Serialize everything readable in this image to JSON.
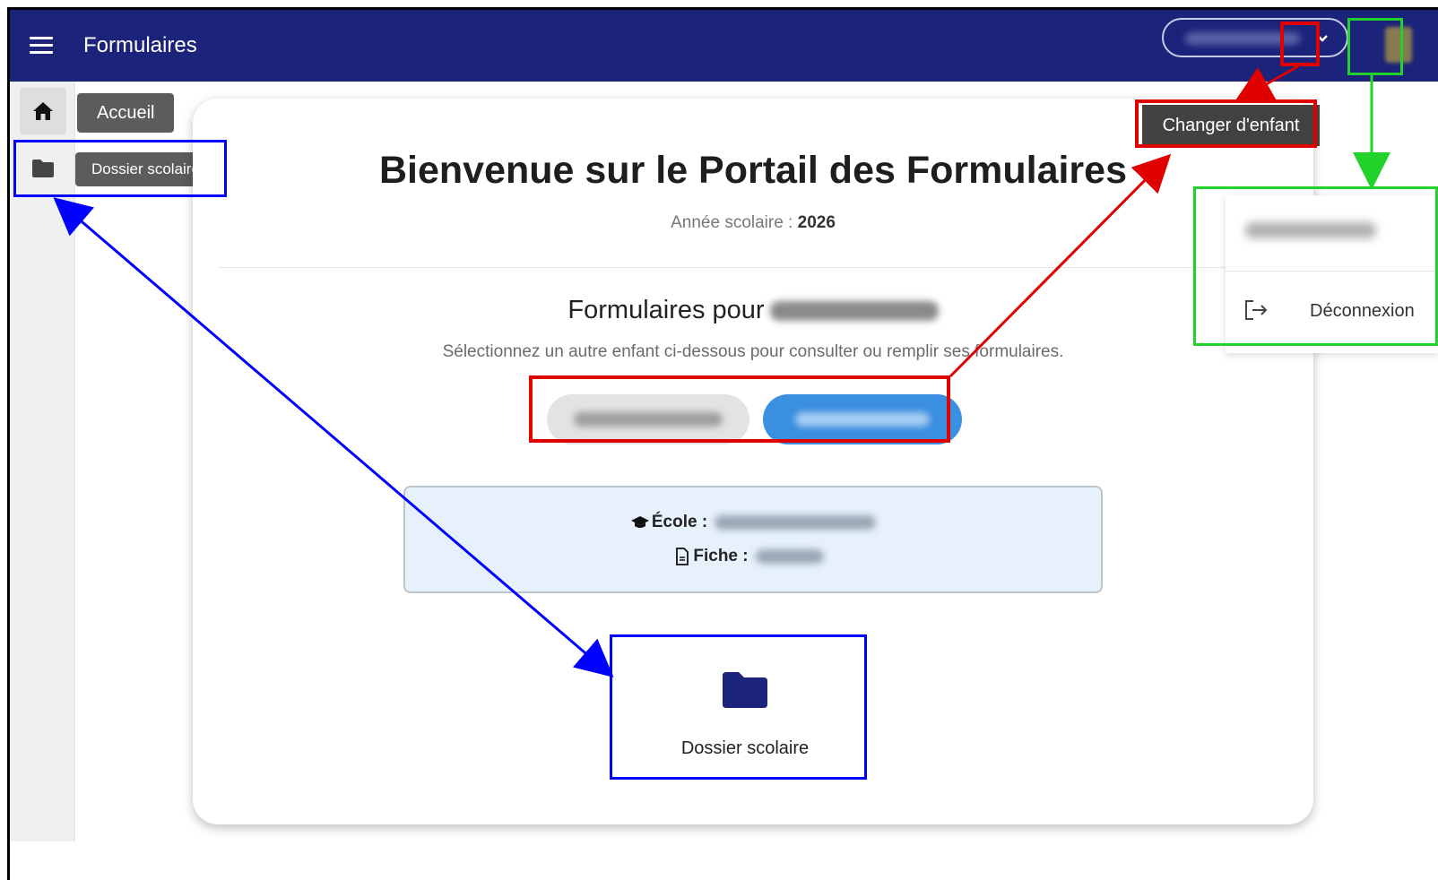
{
  "appbar": {
    "title": "Formulaires",
    "menu_icon": "hamburger-menu-icon",
    "dropdown_icon": "chevron-down-icon",
    "bg_color": "#1b237a"
  },
  "sidebar": {
    "items": [
      {
        "icon": "home-icon",
        "tooltip": "Accueil"
      },
      {
        "icon": "folder-icon",
        "tooltip": "Dossier scolaire"
      }
    ]
  },
  "main": {
    "title": "Bienvenue sur le Portail des Formulaires",
    "year_label": "Année scolaire : ",
    "year_value": "2026",
    "forms_for": "Formulaires pour",
    "hint": "Sélectionnez un autre enfant ci-dessous pour consulter ou remplir ses formulaires.",
    "school_label": "École :",
    "file_label": "Fiche :",
    "folder_card_label": "Dossier scolaire"
  },
  "annotations": {
    "change_child": "Changer d'enfant"
  },
  "user_menu": {
    "logout_label": "Déconnexion",
    "logout_icon": "logout-icon"
  },
  "colors": {
    "primary": "#1b237a",
    "chip_active": "#3a8fe0",
    "annotation_blue": "#0000ff",
    "annotation_red": "#e10000",
    "annotation_green": "#22d22a"
  }
}
